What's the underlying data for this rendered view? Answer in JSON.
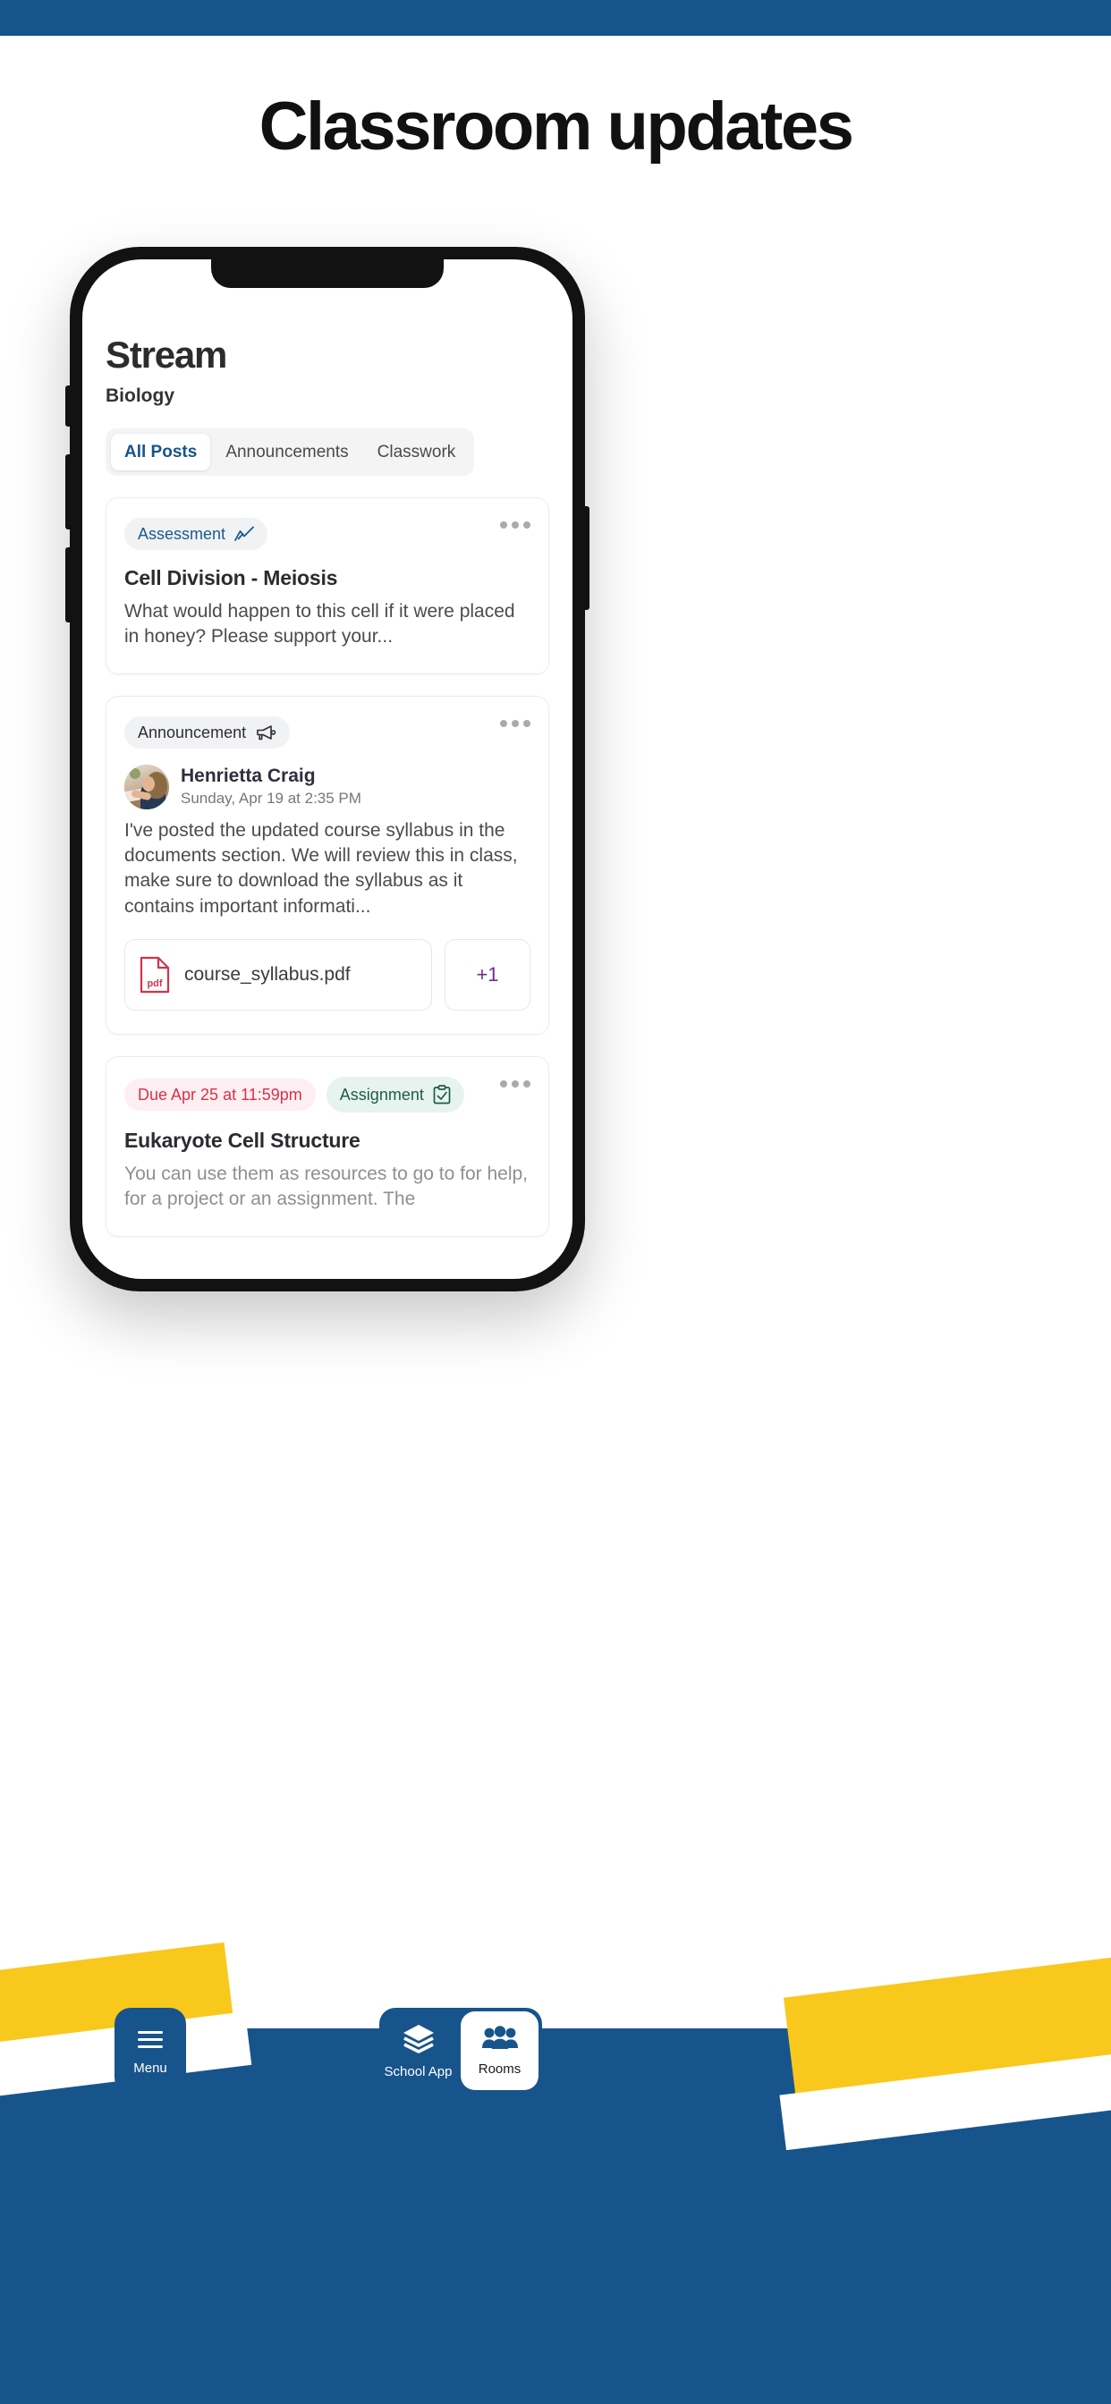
{
  "page": {
    "headline": "Classroom updates",
    "accent_blue": "#18548c",
    "accent_yellow": "#f8c81c"
  },
  "app": {
    "title": "Stream",
    "subtitle": "Biology",
    "tabs": [
      {
        "label": "All Posts",
        "active": true
      },
      {
        "label": "Announcements",
        "active": false
      },
      {
        "label": "Classwork",
        "active": false
      }
    ]
  },
  "posts": [
    {
      "badge": "Assessment",
      "badge_icon": "chart-check-icon",
      "title": "Cell Division - Meiosis",
      "body": "What would happen to this cell if it were placed in honey? Please support your...",
      "menu_icon": "more-options-icon"
    },
    {
      "badge": "Announcement",
      "badge_icon": "megaphone-icon",
      "author": "Henrietta Craig",
      "date": "Sunday, Apr 19 at 2:35 PM",
      "body": "I've posted the updated course syllabus in the documents section. We will review this in class, make sure to download the syllabus as it contains important informati...",
      "attachments": [
        {
          "name": "course_syllabus.pdf",
          "icon": "pdf-file-icon",
          "icon_label": "pdf"
        }
      ],
      "more_attachments": "+1",
      "menu_icon": "more-options-icon"
    },
    {
      "due": "Due Apr 25 at 11:59pm",
      "badge": "Assignment",
      "badge_icon": "clipboard-check-icon",
      "title": "Eukaryote Cell Structure",
      "body": "You can use them as resources to go to for help, for a project or an assignment. The",
      "menu_icon": "more-options-icon"
    }
  ],
  "bottom_nav": {
    "menu": {
      "label": "Menu",
      "icon": "hamburger-icon"
    },
    "school_app": {
      "label": "School App",
      "icon": "layers-icon"
    },
    "rooms": {
      "label": "Rooms",
      "icon": "people-group-icon"
    }
  }
}
